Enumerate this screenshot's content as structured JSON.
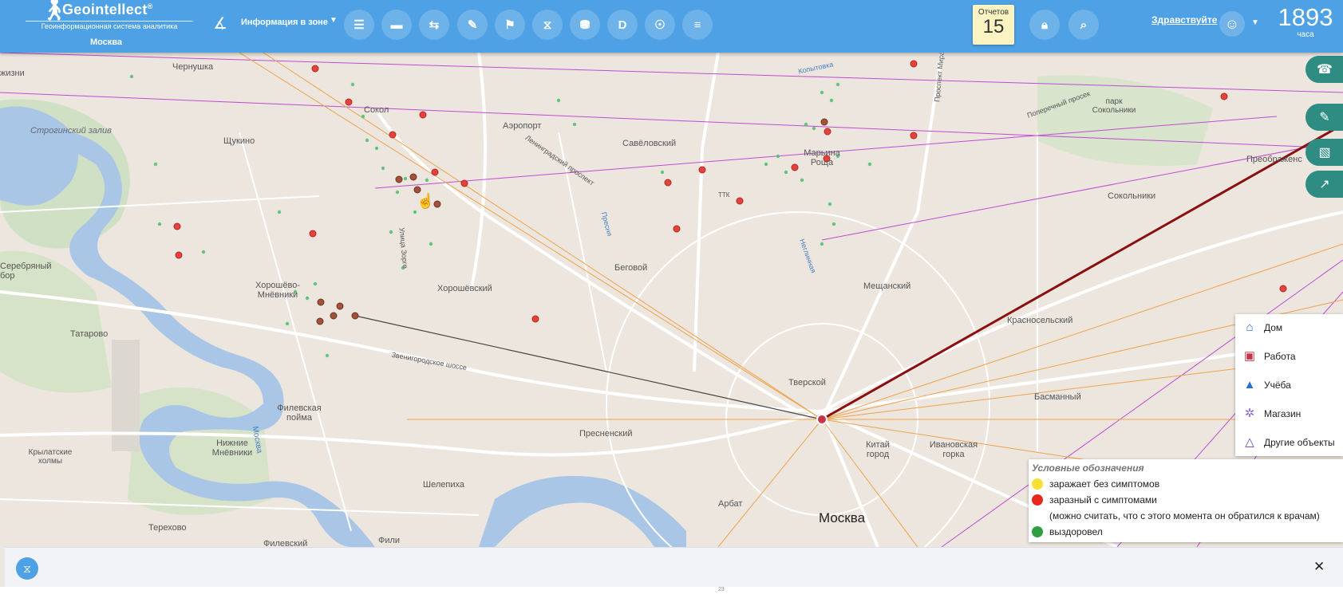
{
  "header": {
    "brand": "Geointellect",
    "trademark": "®",
    "tagline": "Геоинформационная система аналитика",
    "city": "Москва",
    "zone_select": "Информация в зоне",
    "reports_label": "Отчетов",
    "reports_count": "15",
    "greeting": "Здравствуйте",
    "hours_value": "1893",
    "hours_unit": "часа",
    "tool_icons": [
      "layers-icon",
      "id-card-icon",
      "toggle-icon",
      "edit-icon",
      "marker-icon",
      "hourglass-icon",
      "coins-icon",
      "d-letter-icon",
      "network-icon",
      "sliders-icon"
    ],
    "tool_glyph_d": "D"
  },
  "map_labels": {
    "chernushka": "Чернушка",
    "zhizni": "жизни",
    "strogino": "Строгинский залив",
    "sokol": "Сокол",
    "aeroport": "Аэропорт",
    "shchukino": "Щукино",
    "savelovsky": "Савёловский",
    "maryina": "Марьина Роща",
    "leningradsky": "Ленинградский проспект",
    "prospekt_mira": "Проспект Мира",
    "koptevo": "Копытовка",
    "sokolniki": "Сокольники",
    "preobrazh": "Преображенс",
    "park_sokolniki": "парк Сокольники",
    "poperechny": "Поперечный просек",
    "serebryany": "Серебряный бор",
    "khoroshevo": "Хорошёво-Мнёвники",
    "khoroshevsky": "Хорошёвский",
    "begovoy": "Беговой",
    "tatarovo": "Татарово",
    "zvenigorod": "Звенигородское шоссе",
    "meshchansky": "Мещанский",
    "krasnoselsky": "Красносельский",
    "tverskoy": "Тверской",
    "basmanny": "Басманный",
    "presnensky": "Пресненский",
    "filevskaya": "Филевская пойма",
    "nizhnie": "Нижние Мнёвники",
    "krylatskie": "Крылатские холмы",
    "kitay": "Китай город",
    "ivanovskaya": "Ивановская горка",
    "shelepikha": "Шелепиха",
    "arbat": "Арбат",
    "terekhovo": "Терехово",
    "fili": "Фили",
    "filevsky": "Филевский",
    "moskva_city": "Москва",
    "moskva_river": "Москва",
    "ttk": "ТТК",
    "presnya": "Пресня",
    "neglinnaya": "Неглинная",
    "ulitsa_zorge": "Улица Зорге"
  },
  "side_tabs": [
    "phone-icon",
    "eraser-icon",
    "map-layers-icon",
    "chart-icon"
  ],
  "poi_panel": {
    "items": [
      {
        "label": "Дом",
        "icon": "home-icon",
        "color": "#2a6fd6"
      },
      {
        "label": "Работа",
        "icon": "briefcase-icon",
        "color": "#c8334a"
      },
      {
        "label": "Учёба",
        "icon": "graduation-icon",
        "color": "#2a6fd6"
      },
      {
        "label": "Магазин",
        "icon": "cart-icon",
        "color": "#8a6fe0"
      },
      {
        "label": "Другие объекты",
        "icon": "tent-icon",
        "color": "#6a3fb8"
      }
    ]
  },
  "legend": {
    "title": "Условные обозначения",
    "items": [
      {
        "label": "заражает без симптомов",
        "color": "#f7e034"
      },
      {
        "label": "заразный с симптомами",
        "color": "#e8281e"
      },
      {
        "label": "(можно считать, что с этого момента он обратился к врачам)",
        "color": ""
      },
      {
        "label": "выздоровел",
        "color": "#2e9e3e"
      }
    ]
  },
  "bottom": {
    "close": "✕",
    "tick": "23"
  }
}
